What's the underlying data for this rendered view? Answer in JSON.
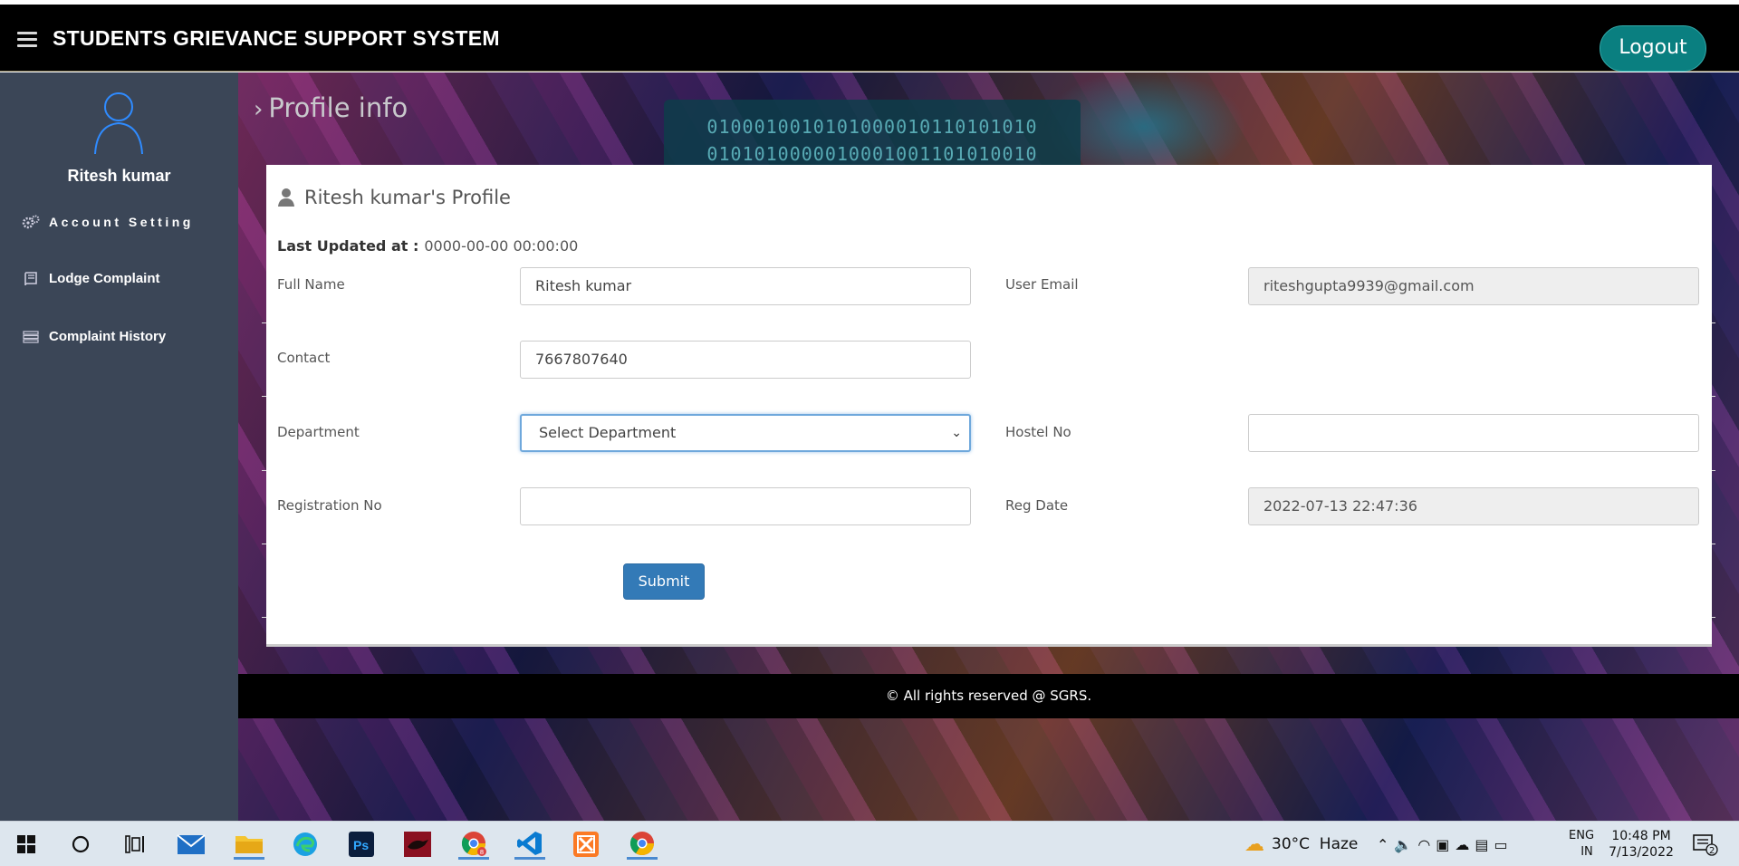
{
  "header": {
    "title": "STUDENTS GRIEVANCE SUPPORT SYSTEM",
    "logout_label": "Logout"
  },
  "sidebar": {
    "user_name": "Ritesh kumar",
    "items": [
      {
        "label": "Account Setting",
        "icon": "gears-icon"
      },
      {
        "label": "Lodge Complaint",
        "icon": "book-icon"
      },
      {
        "label": "Complaint History",
        "icon": "list-icon"
      }
    ]
  },
  "main": {
    "breadcrumb": "Profile info",
    "background_binary": [
      "0100010010101000010110101010",
      "0101010000010001001101010010"
    ]
  },
  "profile": {
    "title": "Ritesh kumar's Profile",
    "last_updated_label": "Last Updated at :",
    "last_updated_value": "0000-00-00 00:00:00",
    "full_name_label": "Full Name",
    "full_name_value": "Ritesh kumar",
    "email_label": "User Email",
    "email_value": "riteshgupta9939@gmail.com",
    "contact_label": "Contact",
    "contact_value": "7667807640",
    "department_label": "Department",
    "department_value": "Select Department",
    "hostel_label": "Hostel No",
    "hostel_value": "",
    "registration_label": "Registration No",
    "registration_value": "",
    "reg_date_label": "Reg Date",
    "reg_date_value": "2022-07-13 22:47:36",
    "submit_label": "Submit"
  },
  "footer": {
    "text": "© All rights reserved @ SGRS."
  },
  "taskbar": {
    "weather": "30°C  Haze",
    "language_top": "ENG",
    "language_bottom": "IN",
    "time": "10:48 PM",
    "date": "7/13/2022",
    "notification_count": "2",
    "chrome_badge": "8"
  },
  "colors": {
    "header_bg": "#000000",
    "sidebar_bg": "#3b4657",
    "logout_bg": "#0a7f80",
    "submit_bg": "#337ab7",
    "taskbar_bg": "#dde6ee"
  }
}
